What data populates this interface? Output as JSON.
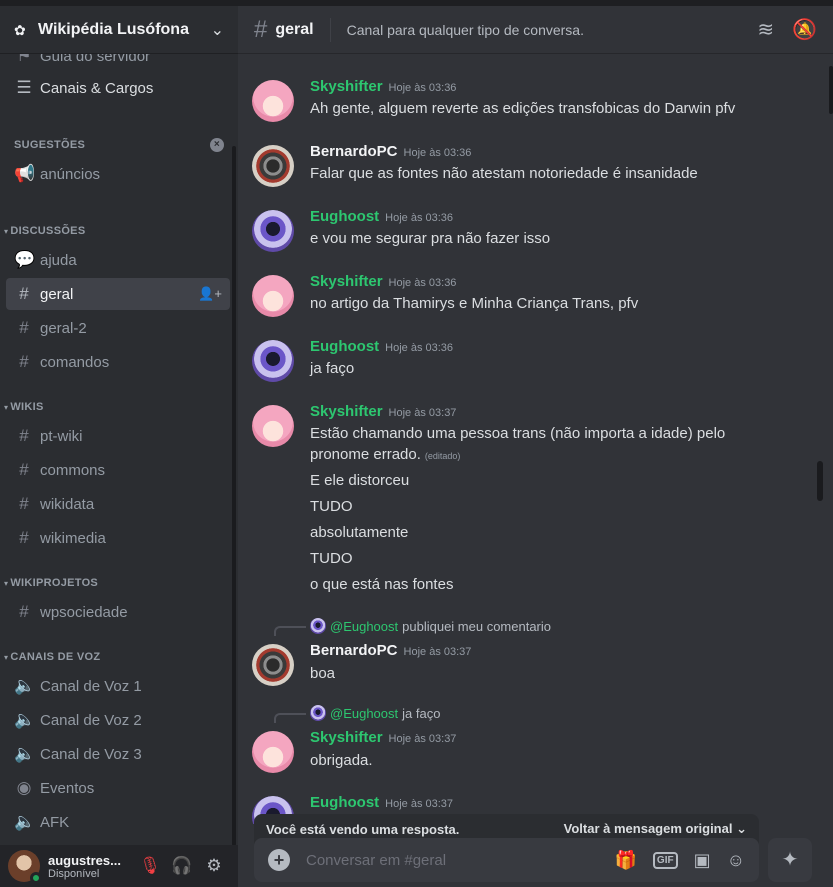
{
  "server": {
    "name": "Wikipédia Lusófona"
  },
  "sidebar": {
    "top_items": [
      {
        "label": "Guia do servidor",
        "icon": "signpost-icon"
      },
      {
        "label": "Canais & Cargos",
        "icon": "channels-list-icon"
      }
    ],
    "sugestoes": {
      "title": "SUGESTÕES",
      "items": [
        {
          "label": "anúncios",
          "icon": "megaphone-icon"
        }
      ]
    },
    "discussoes": {
      "title": "DISCUSSÕES",
      "items": [
        {
          "label": "ajuda",
          "icon": "forum-icon"
        },
        {
          "label": "geral",
          "icon": "hash-icon"
        },
        {
          "label": "geral-2",
          "icon": "hash-icon"
        },
        {
          "label": "comandos",
          "icon": "hash-icon"
        }
      ]
    },
    "wikis": {
      "title": "WIKIS",
      "items": [
        {
          "label": "pt-wiki",
          "icon": "hash-icon"
        },
        {
          "label": "commons",
          "icon": "hash-icon"
        },
        {
          "label": "wikidata",
          "icon": "hash-icon"
        },
        {
          "label": "wikimedia",
          "icon": "hash-icon"
        }
      ]
    },
    "wikiprojetos": {
      "title": "WIKIPROJETOS",
      "items": [
        {
          "label": "wpsociedade",
          "icon": "hash-icon"
        }
      ]
    },
    "canais_voz": {
      "title": "CANAIS DE VOZ",
      "items": [
        {
          "label": "Canal de Voz 1",
          "icon": "speaker-icon"
        },
        {
          "label": "Canal de Voz 2",
          "icon": "speaker-icon"
        },
        {
          "label": "Canal de Voz 3",
          "icon": "speaker-icon"
        },
        {
          "label": "Eventos",
          "icon": "stage-icon"
        },
        {
          "label": "AFK",
          "icon": "speaker-icon"
        }
      ]
    }
  },
  "user": {
    "name": "augustres...",
    "status": "Disponível"
  },
  "channel": {
    "name": "geral",
    "topic": "Canal para qualquer tipo de conversa."
  },
  "messages": [
    {
      "author": "Skyshifter",
      "time": "Hoje às 03:36",
      "lines": [
        "Ah gente, alguem reverte as edições transfobicas do Darwin pfv"
      ]
    },
    {
      "author": "BernardoPC",
      "time": "Hoje às 03:36",
      "lines": [
        "Falar que as fontes não atestam notoriedade é insanidade"
      ]
    },
    {
      "author": "Eughoost",
      "time": "Hoje às 03:36",
      "lines": [
        "e vou me segurar pra não fazer isso"
      ]
    },
    {
      "author": "Skyshifter",
      "time": "Hoje às 03:36",
      "lines": [
        "no artigo da Thamirys e Minha Criança Trans, pfv"
      ]
    },
    {
      "author": "Eughoost",
      "time": "Hoje às 03:36",
      "lines": [
        "ja faço"
      ]
    },
    {
      "author": "Skyshifter",
      "time": "Hoje às 03:37",
      "lines": [
        "Estão chamando uma pessoa trans (não importa a idade) pelo",
        "pronome errado.",
        "E ele distorceu",
        "TUDO",
        "absolutamente",
        "TUDO",
        "o que está nas fontes"
      ],
      "edited": "(editado)"
    },
    {
      "author": "BernardoPC",
      "time": "Hoje às 03:37",
      "reply_to": "@Eughoost",
      "reply_text": "publiquei meu comentario",
      "lines": [
        "boa"
      ]
    },
    {
      "author": "Skyshifter",
      "time": "Hoje às 03:37",
      "reply_to": "@Eughoost",
      "reply_text": "ja faço",
      "lines": [
        "obrigada."
      ]
    },
    {
      "author": "Eughoost",
      "time": "Hoje às 03:37",
      "lines": []
    }
  ],
  "composer": {
    "reply_notice": "Você está vendo uma resposta.",
    "jump_label": "Voltar à mensagem original",
    "placeholder": "Conversar em #geral",
    "gif_label": "GIF"
  },
  "colors": {
    "accent_green": "#2dc770",
    "status_online": "#23a55a",
    "mute_red": "#f23f43"
  }
}
